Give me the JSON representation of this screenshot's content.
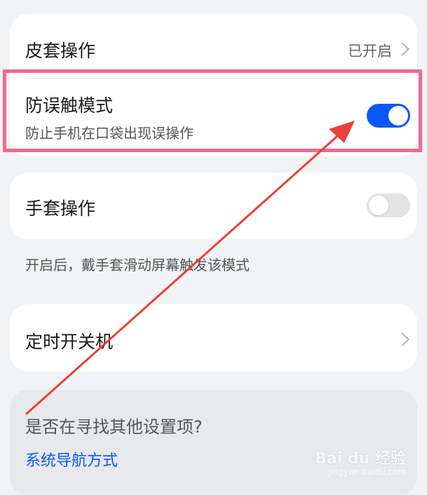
{
  "settings": {
    "cover_mode": {
      "label": "皮套操作",
      "value": "已开启"
    },
    "anti_touch": {
      "label": "防误触模式",
      "description": "防止手机在口袋出现误操作",
      "enabled": true
    },
    "glove_mode": {
      "label": "手套操作",
      "enabled": false,
      "hint": "开启后，戴手套滑动屏幕触发该模式"
    },
    "scheduled_power": {
      "label": "定时开关机"
    }
  },
  "suggestion": {
    "title": "是否在寻找其他设置项?",
    "link": "系统导航方式"
  },
  "watermark": {
    "text": "Bai du 经验",
    "sub": "jingyan.baidu.com"
  },
  "colors": {
    "accent": "#0a59f7",
    "highlight_border": "#ec6b91",
    "arrow": "#e8403a",
    "background": "#f1f3f5"
  }
}
